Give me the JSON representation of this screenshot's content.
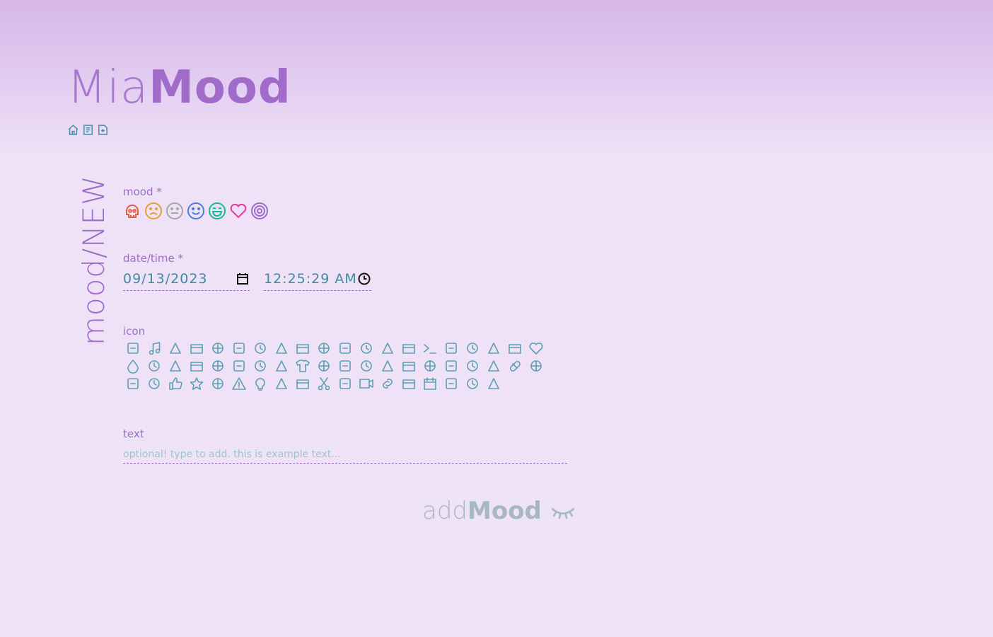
{
  "app": {
    "brand_light": "Mia",
    "brand_bold": "Mood"
  },
  "nav": [
    {
      "icon": "home-icon"
    },
    {
      "icon": "list-icon"
    },
    {
      "icon": "new-entry-icon"
    }
  ],
  "page": {
    "vertical_title": "mood/NEW"
  },
  "form": {
    "mood_label": "mood *",
    "moods": [
      {
        "icon": "skull-face-icon",
        "color": "#e25f44"
      },
      {
        "icon": "sad-face-icon",
        "color": "#e0a236"
      },
      {
        "icon": "neutral-face-icon",
        "color": "#a6a6a6"
      },
      {
        "icon": "smile-face-icon",
        "color": "#4b7be0"
      },
      {
        "icon": "laugh-face-icon",
        "color": "#16b98e"
      },
      {
        "icon": "heart-icon",
        "color": "#e23aa0"
      },
      {
        "icon": "target-icon",
        "color": "#9b6dc8"
      }
    ],
    "datetime_label": "date/time *",
    "date_value": "09/13/2023",
    "time_value": "12:25:29 AM",
    "icon_label": "icon",
    "text_label": "text",
    "text_placeholder": "optional! type to add. this is example text...",
    "submit_light": "add",
    "submit_bold": "Mood"
  },
  "colors": {
    "accent": "#9b6dc8",
    "icon": "#5aa0b4",
    "submit": "#a8b8c2"
  },
  "icon_set": [
    "home-heart-icon",
    "music-icon",
    "sleep-zzz-icon",
    "utensils-icon",
    "cake-icon",
    "coffee-icon",
    "truck-icon",
    "chat-icon",
    "book-icon",
    "gift-icon",
    "cocktail-icon",
    "presentation-icon",
    "pacman-icon",
    "balloon-icon",
    "terminal-icon",
    "bug-icon",
    "flame-icon",
    "plant-icon",
    "cactus-icon",
    "heart-icon",
    "drop-icon",
    "brush-icon",
    "bank-icon",
    "dollar-bill-icon",
    "first-aid-kit-icon",
    "basket-icon",
    "shopping-bag-icon",
    "tools-icon",
    "shirt-icon",
    "clipboard-icon",
    "run-icon",
    "bus-icon",
    "umbrella-icon",
    "moon-stars-icon",
    "trophy-icon",
    "stopwatch-icon",
    "thermometer-icon",
    "medical-box-icon",
    "pill-icon",
    "brain-head-icon",
    "syringe-icon",
    "hiking-icon",
    "thumbs-up-icon",
    "star-icon",
    "pin-icon",
    "warning-icon",
    "lightbulb-icon",
    "zoom-icon",
    "ruler-icon",
    "scissors-icon",
    "printer-icon",
    "video-icon",
    "link-icon",
    "calculator-icon",
    "calendar-icon",
    "paperclip-icon",
    "pencil-icon",
    "alien-icon"
  ]
}
